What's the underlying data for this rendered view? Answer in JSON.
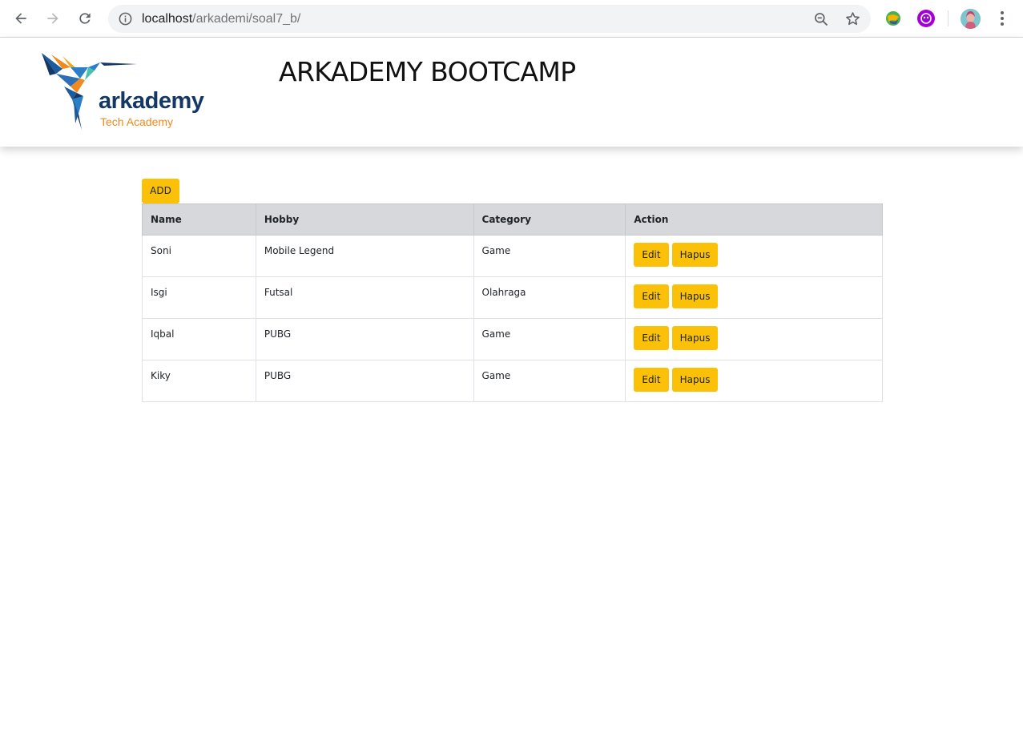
{
  "browser": {
    "url_host": "localhost",
    "url_path": "/arkademi/soal7_b/"
  },
  "header": {
    "logo_brand": "arkademy",
    "logo_tagline": "Tech Academy",
    "title": "ARKADEMY BOOTCAMP"
  },
  "main": {
    "add_label": "ADD",
    "columns": [
      "Name",
      "Hobby",
      "Category",
      "Action"
    ],
    "rows": [
      {
        "name": "Soni",
        "hobby": "Mobile Legend",
        "category": "Game",
        "edit": "Edit",
        "delete": "Hapus"
      },
      {
        "name": "Isgi",
        "hobby": "Futsal",
        "category": "Olahraga",
        "edit": "Edit",
        "delete": "Hapus"
      },
      {
        "name": "Iqbal",
        "hobby": "PUBG",
        "category": "Game",
        "edit": "Edit",
        "delete": "Hapus"
      },
      {
        "name": "Kiky",
        "hobby": "PUBG",
        "category": "Game",
        "edit": "Edit",
        "delete": "Hapus"
      }
    ]
  },
  "colors": {
    "accent": "#fbc108",
    "table_header": "#d6d8db",
    "brand_blue": "#143863",
    "brand_orange": "#f08a1c"
  },
  "icons": {
    "back": "back-arrow-icon",
    "forward": "forward-arrow-icon",
    "reload": "reload-icon",
    "info": "info-icon",
    "zoom": "zoom-out-icon",
    "bookmark": "star-icon",
    "menu": "kebab-menu-icon"
  }
}
